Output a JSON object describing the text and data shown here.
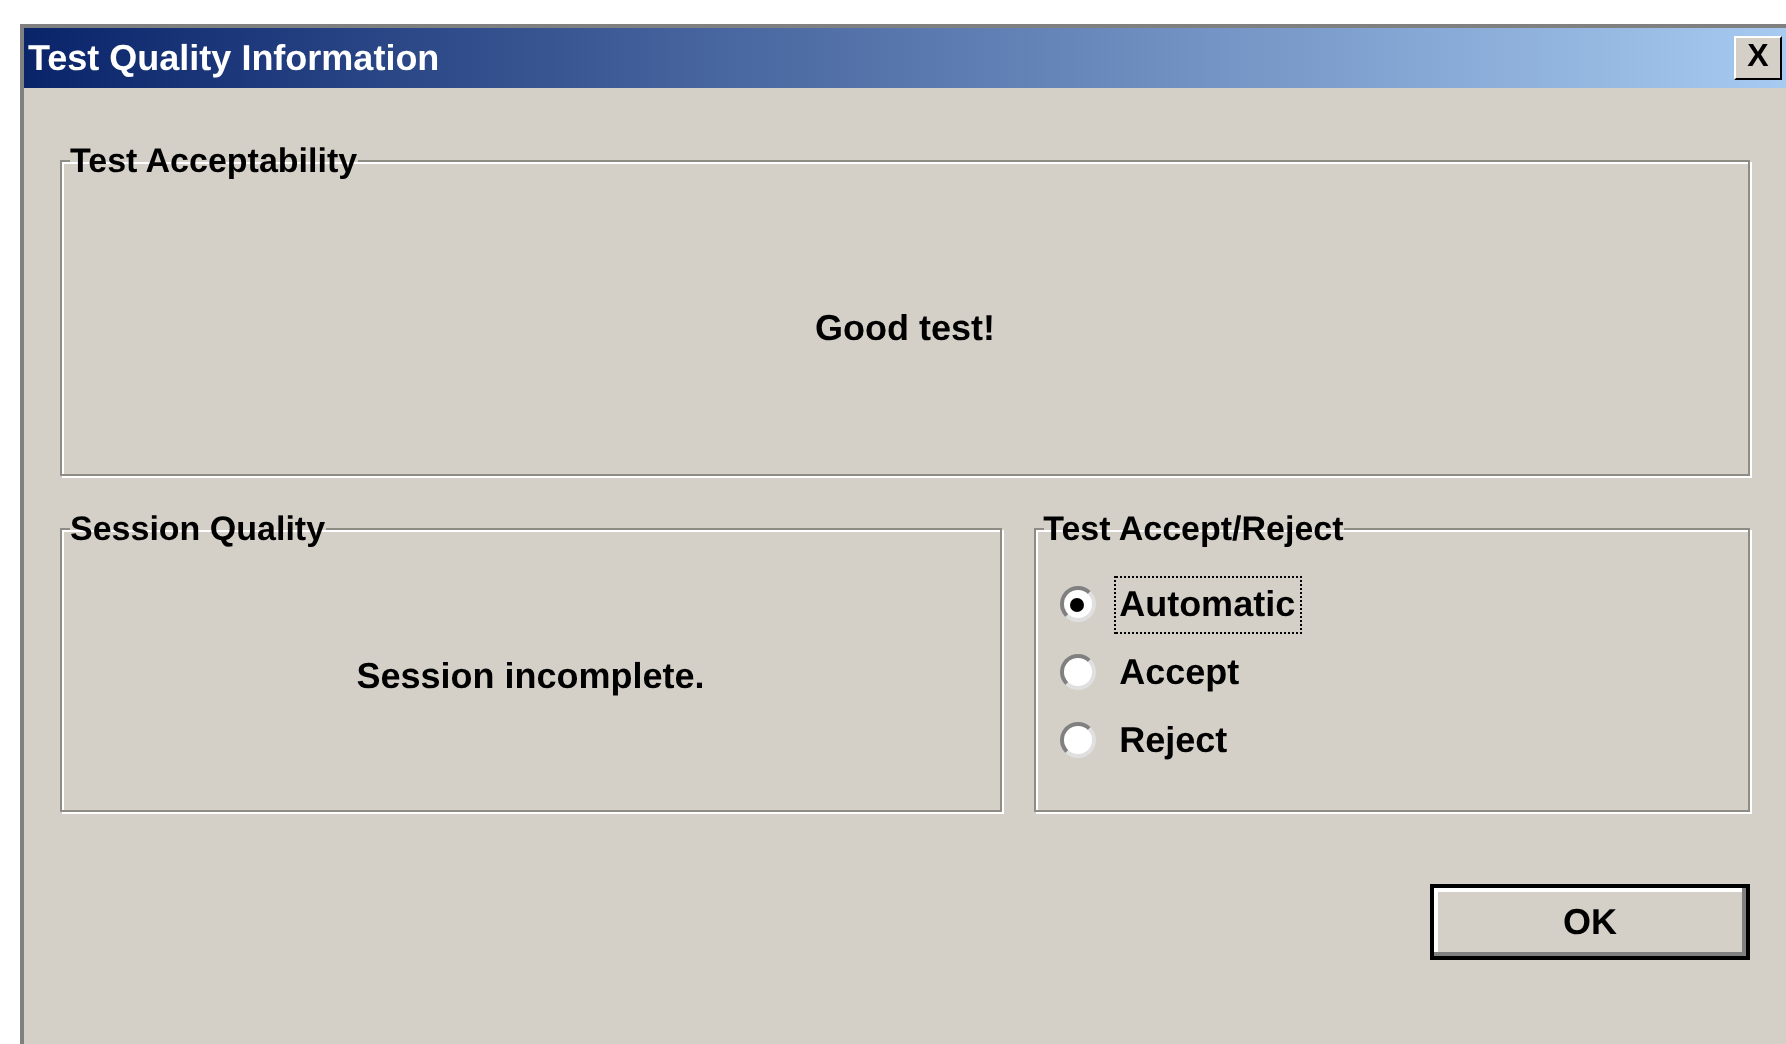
{
  "window": {
    "title": "Test Quality Information",
    "close": "X"
  },
  "acceptability": {
    "title": "Test Acceptability",
    "message": "Good test!"
  },
  "session": {
    "title": "Session Quality",
    "message": "Session incomplete."
  },
  "accept_reject": {
    "title": "Test Accept/Reject",
    "options": [
      {
        "label": "Automatic",
        "selected": true,
        "focused": true
      },
      {
        "label": "Accept",
        "selected": false,
        "focused": false
      },
      {
        "label": "Reject",
        "selected": false,
        "focused": false
      }
    ]
  },
  "buttons": [
    {
      "label": "OK",
      "default": true
    }
  ]
}
